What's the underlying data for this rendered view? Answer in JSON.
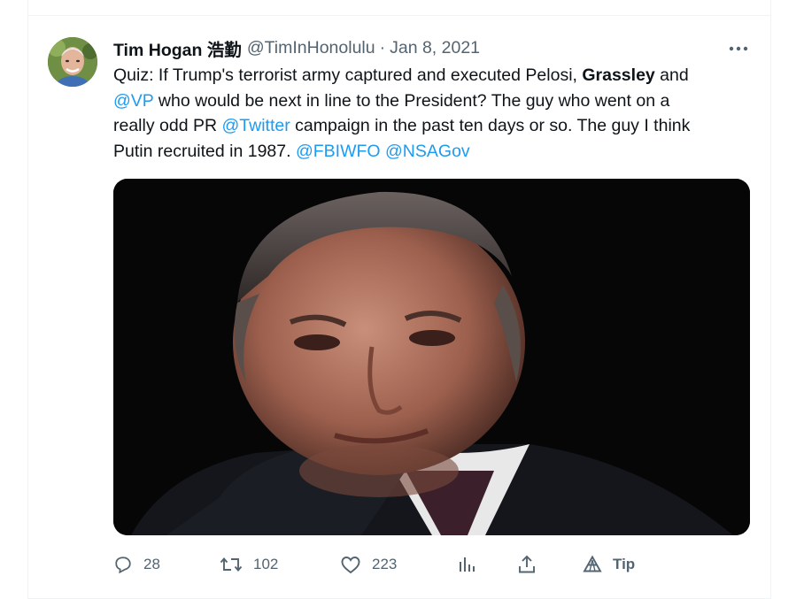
{
  "tweet": {
    "author": {
      "display_name": "Tim Hogan 浩勤",
      "handle": "@TimInHonolulu",
      "separator": "·",
      "date": "Jan 8, 2021"
    },
    "more_icon": "more-horizontal-icon",
    "text": {
      "line1_before": "Quiz:  If Trump's terrorist army captured and executed Pelosi, ",
      "bold_name": "Grassley",
      "line1_after": " and",
      "mention_vp": "@VP",
      "line2": " who would be next in line to the President? The guy who went on a",
      "line3_before": "really odd PR ",
      "mention_twitter": "@Twitter",
      "line3_after": " campaign in the past ten days or so. The guy I think",
      "line4_before": "Putin recruited in 1987. ",
      "mention_fbi": "@FBIWFO",
      "space": " ",
      "mention_nsa": "@NSAGov"
    },
    "media": {
      "description_icon": "photo-of-man-in-suit"
    },
    "actions": {
      "reply": {
        "icon": "reply-icon",
        "count": "28"
      },
      "retweet": {
        "icon": "retweet-icon",
        "count": "102"
      },
      "like": {
        "icon": "like-icon",
        "count": "223"
      },
      "views": {
        "icon": "analytics-icon"
      },
      "share": {
        "icon": "share-icon"
      },
      "tip": {
        "icon": "tip-icon",
        "label": "Tip"
      }
    },
    "colors": {
      "link": "#1d9bf0",
      "secondary": "#536471",
      "text": "#0f1419"
    }
  }
}
